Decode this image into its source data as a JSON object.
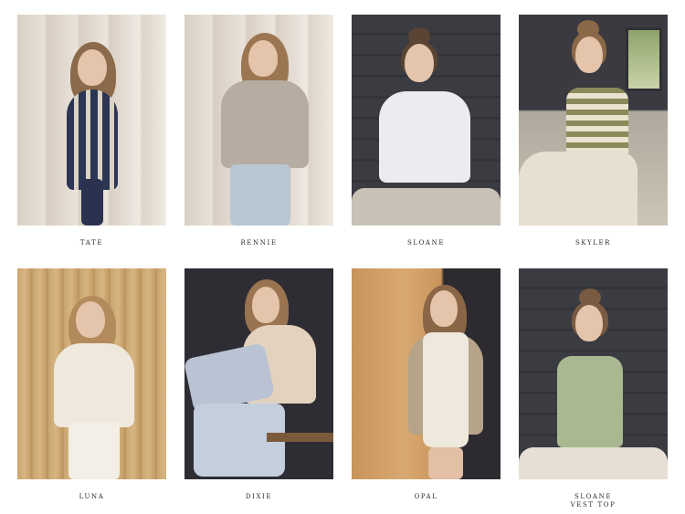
{
  "products": [
    {
      "name": "TATE",
      "subtitle": ""
    },
    {
      "name": "RENNIE",
      "subtitle": ""
    },
    {
      "name": "SLOANE",
      "subtitle": ""
    },
    {
      "name": "SKYLER",
      "subtitle": ""
    },
    {
      "name": "LUNA",
      "subtitle": ""
    },
    {
      "name": "DIXIE",
      "subtitle": ""
    },
    {
      "name": "OPAL",
      "subtitle": ""
    },
    {
      "name": "SLOANE",
      "subtitle": "VEST TOP"
    }
  ]
}
